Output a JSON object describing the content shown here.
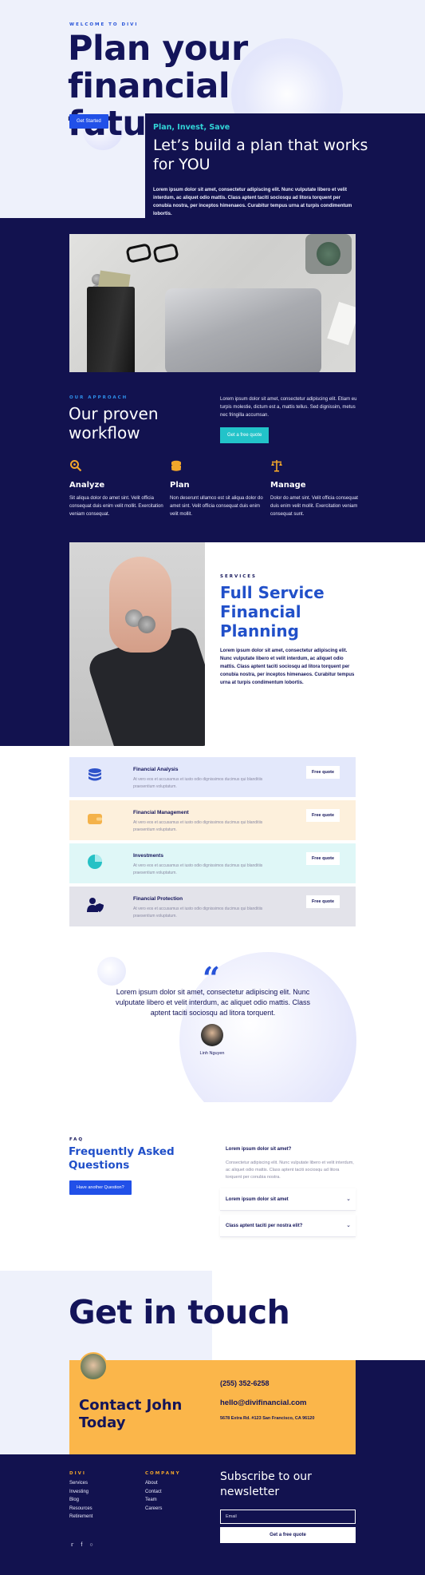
{
  "hero": {
    "eyebrow": "WELCOME TO DIVI",
    "title": "Plan your financial future",
    "cta": "Get Started",
    "card": {
      "kicker": "Plan, Invest, Save",
      "heading": "Let’s build a plan that works for YOU",
      "body": "Lorem ipsum dolor sit amet, consectetur adipiscing elit. Nunc vulputate libero et velit interdum, ac aliquet odio mattis. Class aptent taciti sociosqu ad litora torquent per conubia nostra, per inceptos himenaeos. Curabitur tempus urna at turpis condimentum lobortis."
    }
  },
  "approach": {
    "eyebrow": "OUR APPROACH",
    "title": "Our proven workflow",
    "description": "Lorem ipsum dolor sit amet, consectetur adipiscing elit. Etiam eu turpis molestie, dictum est a, mattis tellus. Sed dignissim, metus nec fringilla accumsan.",
    "cta": "Get a free quote",
    "features": [
      {
        "title": "Analyze",
        "body": "Sit aliqua dolor do amet sint. Velit officia consequat duis enim velit mollit. Exercitation veniam consequat.",
        "icon": "magnifier-icon"
      },
      {
        "title": "Plan",
        "body": "Non deserunt ullamco est sit aliqua dolor do amet sint. Velit officia consequat duis enim velit mollit.",
        "icon": "coins-icon"
      },
      {
        "title": "Manage",
        "body": "Dolor do amet sint. Velit officia consequat duis enim velit mollit. Exercitation veniam consequat sunt.",
        "icon": "scales-icon"
      }
    ]
  },
  "services": {
    "eyebrow": "SERVICES",
    "title": "Full Service Financial Planning",
    "body": "Lorem ipsum dolor sit amet, consectetur adipiscing elit. Nunc vulputate libero et velit interdum, ac aliquet odio mattis. Class aptent taciti sociosqu ad litora torquent per conubia nostra, per inceptos himenaeos. Curabitur tempus urna at turpis condimentum lobortis.",
    "items": [
      {
        "title": "Financial Analysis",
        "body": "At vero eos et accusamus et iusto odio dignissimos ducimus qui blanditiis praesentium voluptatum.",
        "cta": "Free quote",
        "bg": "#e3e8fb",
        "icon": "database-icon",
        "icon_color": "#2e52c9"
      },
      {
        "title": "Financial Management",
        "body": "At vero eos et accusamus et iusto odio dignissimos ducimus qui blanditiis praesentium voluptatum.",
        "cta": "Free quote",
        "bg": "#fdf0dc",
        "icon": "wallet-icon",
        "icon_color": "#f4b24a"
      },
      {
        "title": "Investments",
        "body": "At vero eos et accusamus et iusto odio dignissimos ducimus qui blanditiis praesentium voluptatum.",
        "cta": "Free quote",
        "bg": "#dff7f7",
        "icon": "pie-chart-icon",
        "icon_color": "#26c1c5"
      },
      {
        "title": "Financial Protection",
        "body": "At vero eos et accusamus et iusto odio dignissimos ducimus qui blanditiis praesentium voluptatum.",
        "cta": "Free quote",
        "bg": "#e3e3ea",
        "icon": "user-shield-icon",
        "icon_color": "#13145a"
      }
    ]
  },
  "testimonial": {
    "quote": "Lorem ipsum dolor sit amet, consectetur adipiscing elit. Nunc vulputate libero et velit interdum, ac aliquet odio mattis. Class aptent taciti sociosqu ad litora torquent.",
    "name": "Linh Nguyen"
  },
  "faq": {
    "eyebrow": "FAQ",
    "title": "Frequently Asked Questions",
    "cta": "Have another Question?",
    "open_question": "Lorem ipsum dolor sit amet?",
    "open_answer": "Consectetur adipiscing elit. Nunc vulputate libero et velit interdum, ac aliquet odio mattis. Class aptent taciti sociosqu ad litora torquent per conubia nostra.",
    "collapsed": [
      {
        "question": "Lorem ipsum dolor sit amet"
      },
      {
        "question": "Class aptent taciti per nostra elit?"
      }
    ]
  },
  "contact": {
    "title": "Get in touch",
    "card_title": "Contact John Today",
    "phone": "(255) 352-6258",
    "email": "hello@divifinancial.com",
    "address": "5678 Extra Rd. #123 San Francisco, CA 96120"
  },
  "footer": {
    "col1_title": "DIVI",
    "col1_links": [
      "Services",
      "Investing",
      "Blog",
      "Resources",
      "Retirement"
    ],
    "col2_title": "COMPANY",
    "col2_links": [
      "About",
      "Contact",
      "Team",
      "Careers"
    ],
    "newsletter_title": "Subscribe to our newsletter",
    "email_placeholder": "Email",
    "subscribe_cta": "Get a free quote",
    "social": [
      "twitter-icon",
      "facebook-icon",
      "instagram-icon"
    ]
  }
}
